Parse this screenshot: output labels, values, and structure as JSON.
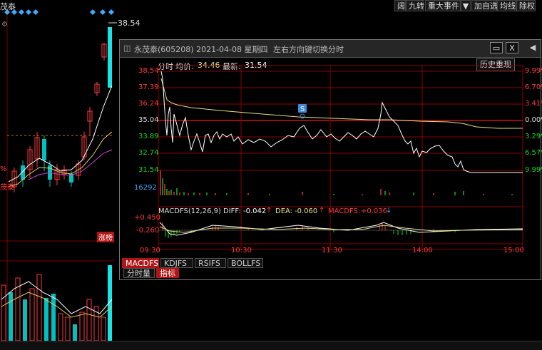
{
  "background": {
    "stock_name_partial": "茂泰",
    "price_label": "38.54",
    "badge": "涨榜",
    "left_pct": "%"
  },
  "toolbar": {
    "btn1": "阔",
    "btn2": "九转",
    "btn3": "重大事件",
    "btn4": "加自选",
    "btn5": "均线",
    "btn6": "除权"
  },
  "window": {
    "title": "永茂泰(605208) 2021-04-08 星期四",
    "hint": "左右方向键切换分时",
    "history_button": "历史重现",
    "close_glyph": "X",
    "minimize_glyph": "▭"
  },
  "info": {
    "label_fenshi": "分时",
    "label_avg": "均价:",
    "avg_value": "34.46",
    "label_latest": "最新:",
    "latest_value": "31.54",
    "marker_s": "S"
  },
  "price_axis_left": [
    "38.54",
    "37.39",
    "36.24",
    "35.04",
    "33.89",
    "32.74",
    "31.54"
  ],
  "pct_axis_right": [
    "9.99%",
    "6.70%",
    "3.41%",
    "0.00%",
    "3.29%",
    "6.57%",
    "9.99%"
  ],
  "volume_label": "16292",
  "macd": {
    "title": "MACDFS(12,26,9)",
    "diff_label": "DIFF:",
    "diff_value": "-0.042",
    "dea_label": "DEA:",
    "dea_value": "-0.060",
    "macdfs_label": "MACDFS:",
    "macdfs_value": "+0.036",
    "axis_top": "+0.450",
    "axis_mid": "-0.260"
  },
  "time_axis": [
    "09:30",
    "10:30",
    "11:30",
    "14:00",
    "15:00"
  ],
  "tabs": [
    "MACDFS",
    "KDJFS",
    "RSIFS",
    "BOLLFS"
  ],
  "subtabs": [
    "分时量",
    "指标"
  ],
  "colors": {
    "up": "#ff3b3b",
    "down": "#00c0c0",
    "green": "#18d418",
    "price_line": "#ffffff",
    "avg_line": "#e6e08a",
    "grid": "#8b0000"
  }
}
